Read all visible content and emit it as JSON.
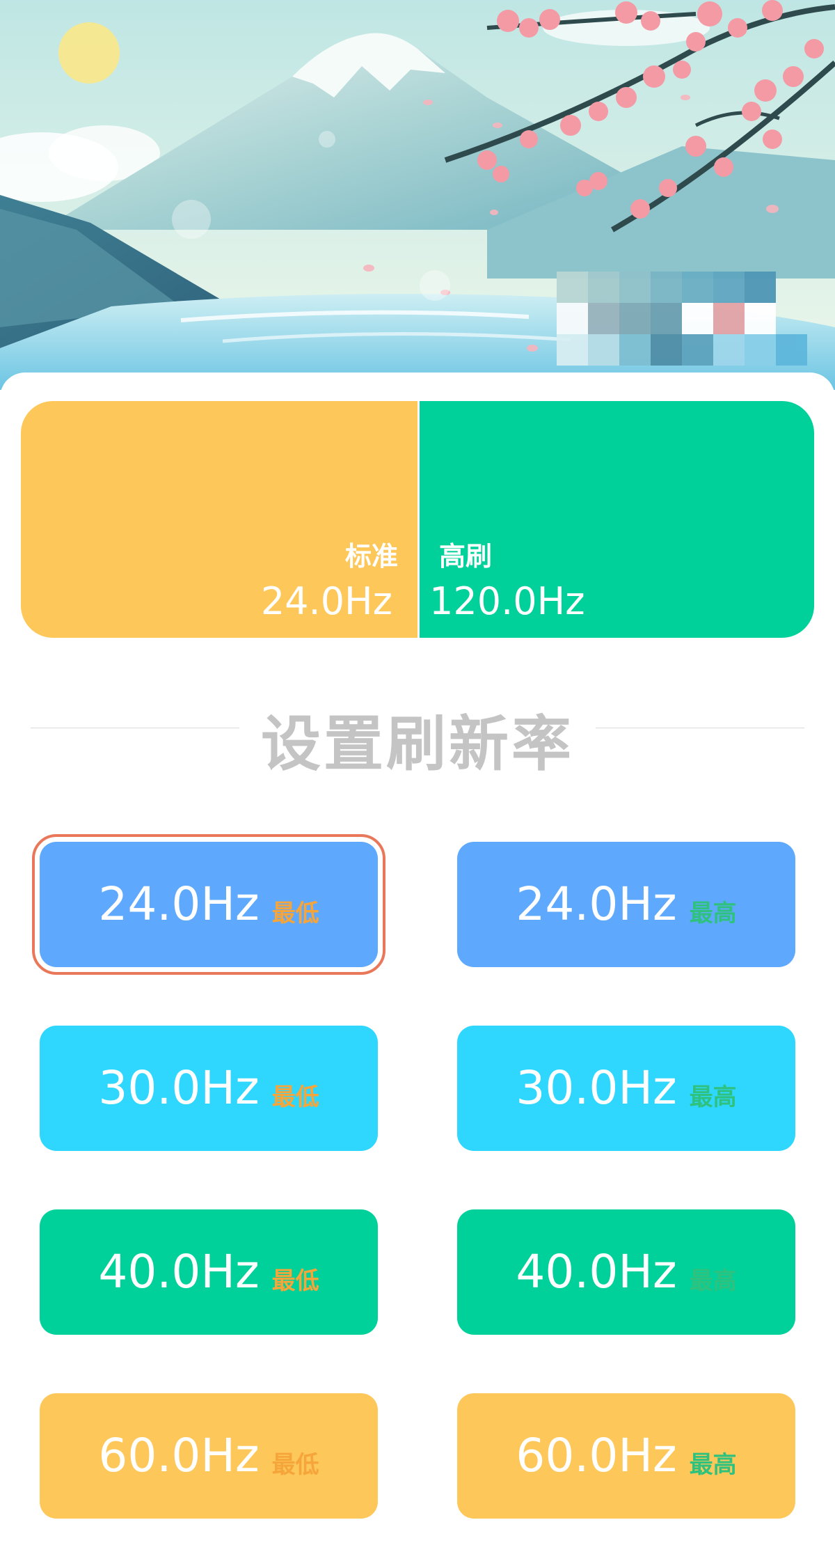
{
  "colors": {
    "yellow": "#fec759",
    "green": "#00d09a",
    "blue": "#5ea9fe",
    "cyan": "#2fd7ff",
    "tag_min": "#f5a53a",
    "tag_max": "#2ec27e",
    "selection_outline": "#e9775a",
    "heading_gray": "#c4c4c4"
  },
  "summary": {
    "standard": {
      "label": "标准",
      "value": "24.0Hz"
    },
    "high": {
      "label": "高刷",
      "value": "120.0Hz"
    }
  },
  "section": {
    "title": "设置刷新率"
  },
  "rates": [
    {
      "min": {
        "hz": "24.0Hz",
        "tag": "最低"
      },
      "max": {
        "hz": "24.0Hz",
        "tag": "最高"
      },
      "color": "blue"
    },
    {
      "min": {
        "hz": "30.0Hz",
        "tag": "最低"
      },
      "max": {
        "hz": "30.0Hz",
        "tag": "最高"
      },
      "color": "cyan"
    },
    {
      "min": {
        "hz": "40.0Hz",
        "tag": "最低"
      },
      "max": {
        "hz": "40.0Hz",
        "tag": "最高"
      },
      "color": "green"
    },
    {
      "min": {
        "hz": "60.0Hz",
        "tag": "最低"
      },
      "max": {
        "hz": "60.0Hz",
        "tag": "最高"
      },
      "color": "yellow"
    }
  ],
  "selected": "rates.0.min"
}
